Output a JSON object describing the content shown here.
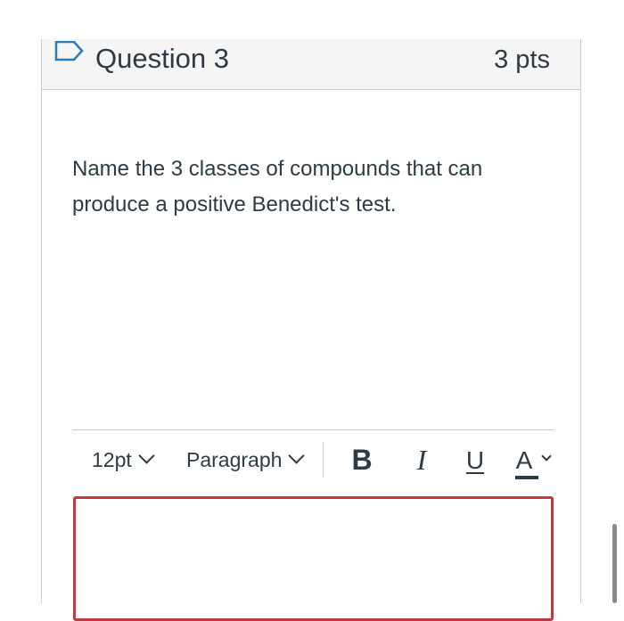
{
  "question": {
    "title": "Question 3",
    "points": "3 pts",
    "flag_icon": "flag-outline-icon",
    "text": "Name the 3 classes of compounds that can produce a positive Benedict's test."
  },
  "toolbar": {
    "font_size": "12pt",
    "block_format": "Paragraph",
    "bold_label": "B",
    "italic_label": "I",
    "underline_label": "U",
    "text_color_label": "A",
    "chevron_icon": "chevron-down-icon"
  },
  "editor": {
    "value": "",
    "border_color": "#c0393e"
  },
  "colors": {
    "text": "#2d3b45",
    "header_bg": "#f5f5f5",
    "border": "#c7cdd1"
  }
}
